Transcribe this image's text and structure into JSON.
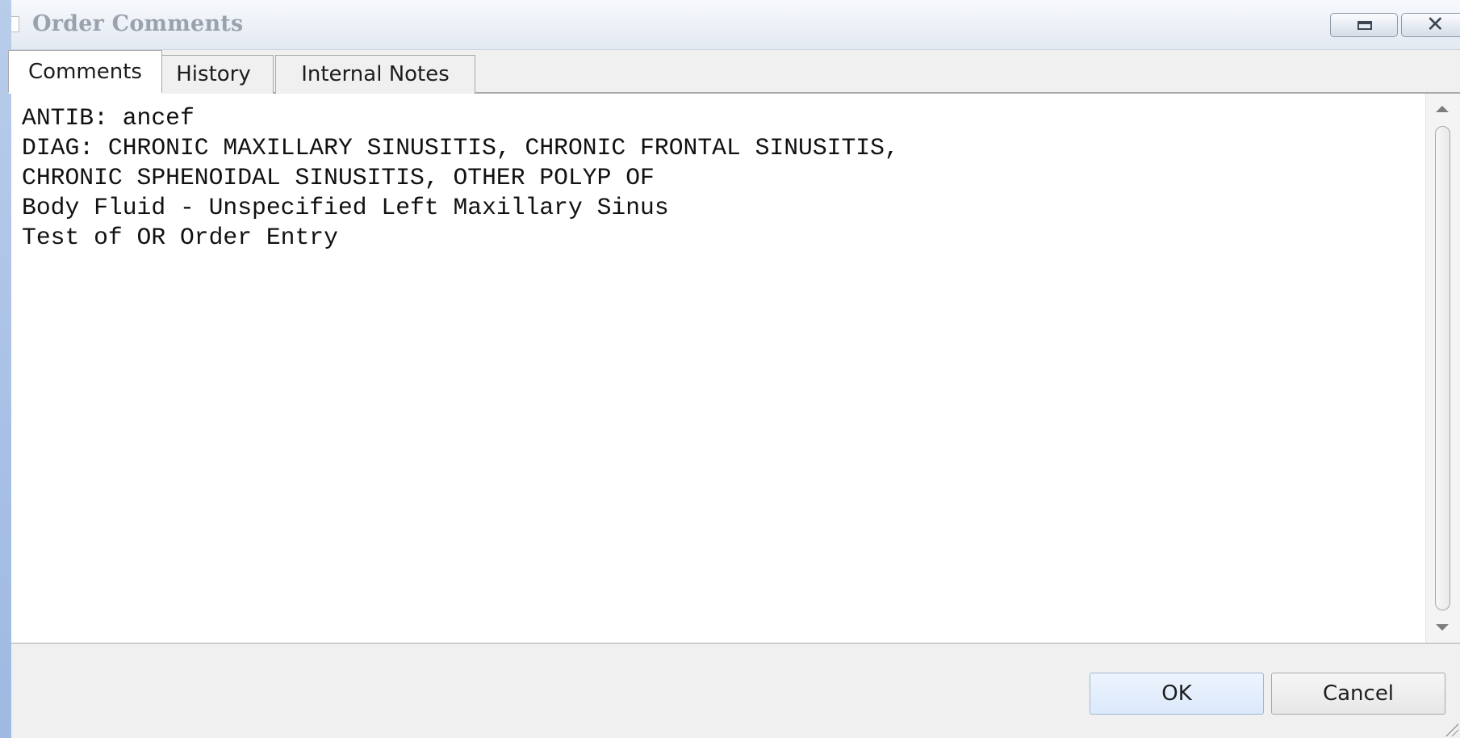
{
  "window": {
    "title": "Order Comments",
    "restore_icon": "restore-icon",
    "close_icon": "close-icon"
  },
  "tabs": [
    {
      "label": "Comments",
      "active": true
    },
    {
      "label": "History",
      "active": false
    },
    {
      "label": "Internal Notes",
      "active": false
    }
  ],
  "comments": {
    "text": "ANTIB: ancef\nDIAG: CHRONIC MAXILLARY SINUSITIS, CHRONIC FRONTAL SINUSITIS,\nCHRONIC SPHENOIDAL SINUSITIS, OTHER POLYP OF\nBody Fluid - Unspecified Left Maxillary Sinus\nTest of OR Order Entry"
  },
  "footer": {
    "ok_label": "OK",
    "cancel_label": "Cancel"
  },
  "colors": {
    "desktop_blue": "#a8c0e6",
    "ok_button": "#dbe9fb",
    "title_text": "#9aa3ad"
  }
}
